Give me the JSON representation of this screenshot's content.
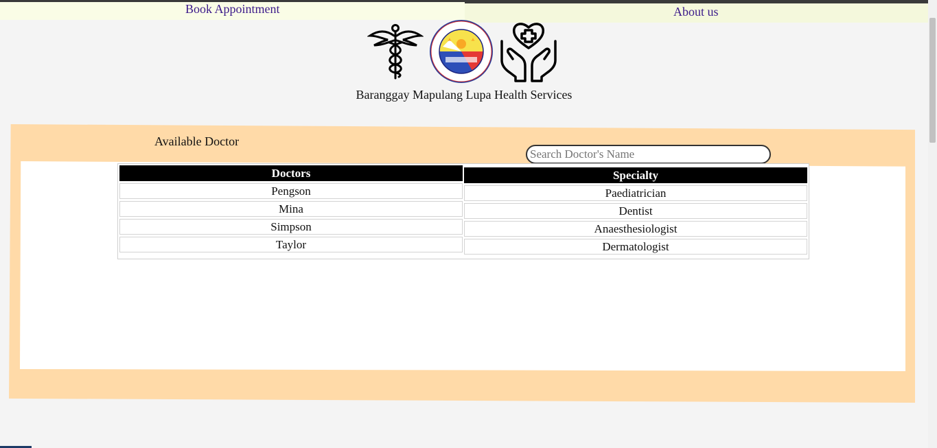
{
  "nav": {
    "book_appointment": "Book Appointment",
    "about_us": "About us"
  },
  "header": {
    "title": "Baranggay Mapulang Lupa Health Services"
  },
  "doctors_panel": {
    "heading": "Available Doctor",
    "search_placeholder": "Search Doctor's Name",
    "columns": [
      "Doctors",
      "Specialty"
    ],
    "rows": [
      {
        "doctor": "Pengson",
        "specialty": "Paediatrician"
      },
      {
        "doctor": "Mina",
        "specialty": "Dentist"
      },
      {
        "doctor": "Simpson",
        "specialty": "Anaesthesiologist"
      },
      {
        "doctor": "Taylor",
        "specialty": "Dermatologist"
      }
    ]
  },
  "icons": [
    "caduceus-icon",
    "barangay-seal-logo",
    "hands-heart-icon"
  ],
  "colors": {
    "panel_bg": "#ffdaa8",
    "nav_bg": "#fafde6",
    "link": "#3b1a8a",
    "header_cell": "#000000"
  }
}
